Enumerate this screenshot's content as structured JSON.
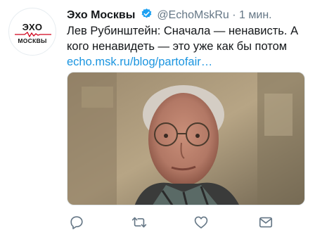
{
  "account": {
    "name": "Эхо Москвы",
    "handle": "@EchoMskRu",
    "separator": "·",
    "time": "1 мин.",
    "avatar_text_top": "ЭХО",
    "avatar_text_bottom": "МОСКВЫ",
    "verified_color": "#1da1f2"
  },
  "tweet": {
    "text": "Лев Рубинштейн: Сначала — ненависть. А кого ненавидеть — это уже как бы потом",
    "link": "echo.msk.ru/blog/partofair…",
    "link_color": "#1b95e0"
  },
  "media": {
    "description_icon": "photo-portrait"
  },
  "actions": [
    {
      "name": "reply",
      "icon": "speech-bubble-icon"
    },
    {
      "name": "retweet",
      "icon": "retweet-icon"
    },
    {
      "name": "like",
      "icon": "heart-icon"
    },
    {
      "name": "share",
      "icon": "mail-icon"
    }
  ]
}
